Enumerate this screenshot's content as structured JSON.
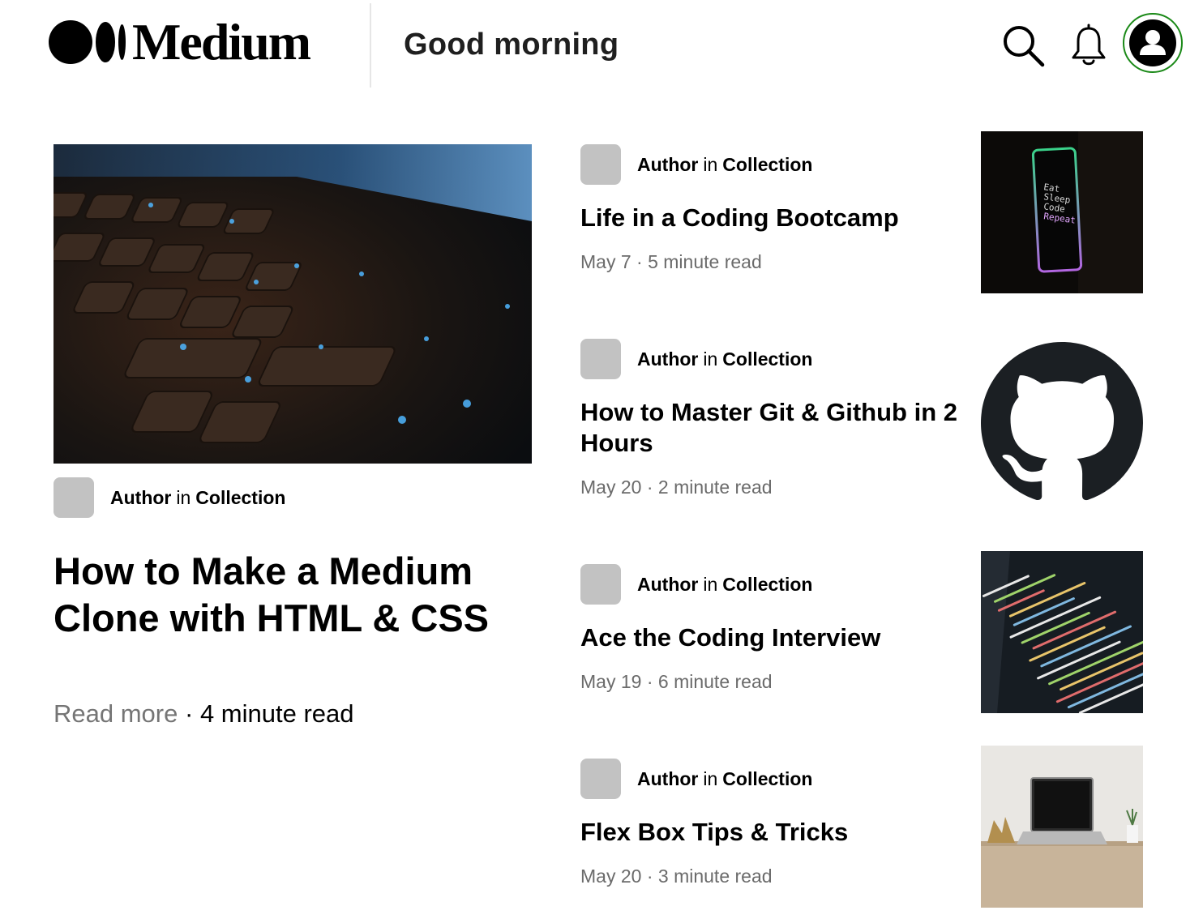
{
  "header": {
    "logo_text": "Medium",
    "greeting": "Good morning",
    "icons": {
      "search": "search-icon",
      "bell": "bell-icon",
      "profile": "user-icon"
    },
    "accent_color": "#1a8917"
  },
  "featured": {
    "author": "Author",
    "in": "in",
    "collection": "Collection",
    "title": "How to Make a Medium Clone with HTML & CSS",
    "read_more": "Read more",
    "separator": "·",
    "read_time": "4 minute read"
  },
  "articles": [
    {
      "author": "Author",
      "in": "in",
      "collection": "Collection",
      "title": "Life in a Coding Bootcamp",
      "date": "May 7",
      "separator": "·",
      "read_time": "5 minute read",
      "thumb_text": [
        "Eat",
        "Sleep",
        "Code",
        "Repeat"
      ]
    },
    {
      "author": "Author",
      "in": "in",
      "collection": "Collection",
      "title": "How to Master Git & Github in 2 Hours",
      "date": "May 20",
      "separator": "·",
      "read_time": "2 minute read"
    },
    {
      "author": "Author",
      "in": "in",
      "collection": "Collection",
      "title": "Ace the Coding Interview",
      "date": "May 19",
      "separator": "·",
      "read_time": "6 minute read"
    },
    {
      "author": "Author",
      "in": "in",
      "collection": "Collection",
      "title": "Flex Box Tips & Tricks",
      "date": "May 20",
      "separator": "·",
      "read_time": "3 minute read"
    }
  ]
}
